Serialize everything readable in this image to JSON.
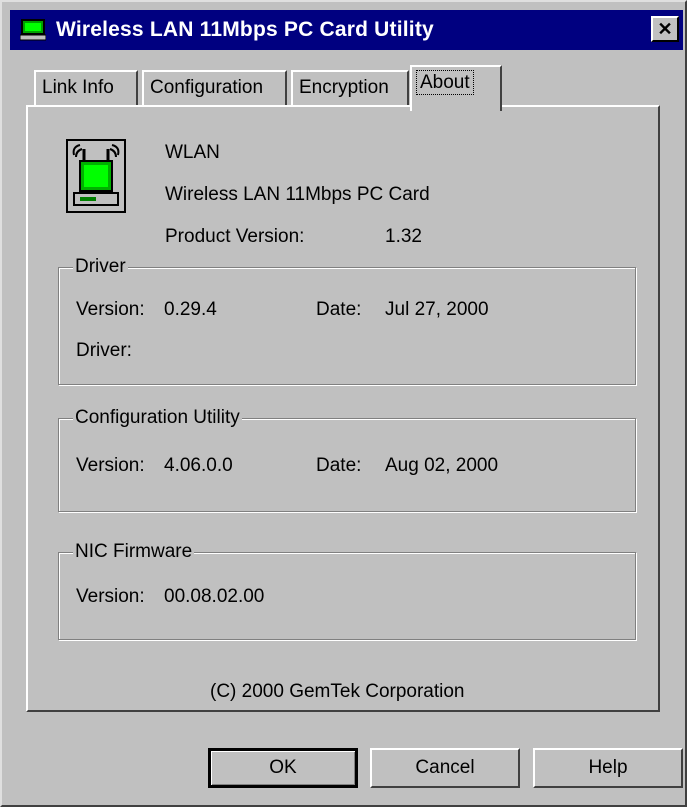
{
  "window": {
    "title": "Wireless LAN 11Mbps PC Card Utility",
    "close_label": "✕"
  },
  "tabs": [
    {
      "label": "Link Info"
    },
    {
      "label": "Configuration"
    },
    {
      "label": "Encryption"
    },
    {
      "label": "About",
      "active": true
    }
  ],
  "product": {
    "name": "WLAN",
    "description": "Wireless LAN 11Mbps PC Card",
    "version_label": "Product Version:",
    "version_value": "1.32",
    "icon": "wlan-card-icon"
  },
  "driver": {
    "legend": "Driver",
    "version_label": "Version:",
    "version_value": "0.29.4",
    "date_label": "Date:",
    "date_value": "Jul 27, 2000",
    "driver_label": "Driver:"
  },
  "config_utility": {
    "legend": "Configuration Utility",
    "version_label": "Version:",
    "version_value": "4.06.0.0",
    "date_label": "Date:",
    "date_value": "Aug 02, 2000"
  },
  "nic_firmware": {
    "legend": "NIC Firmware",
    "version_label": "Version:",
    "version_value": "00.08.02.00"
  },
  "copyright": "(C) 2000 GemTek Corporation",
  "buttons": {
    "ok": "OK",
    "cancel": "Cancel",
    "help": "Help"
  },
  "colors": {
    "titlebar": "#000080",
    "face": "#c0c0c0",
    "icon_green": "#00c000"
  }
}
